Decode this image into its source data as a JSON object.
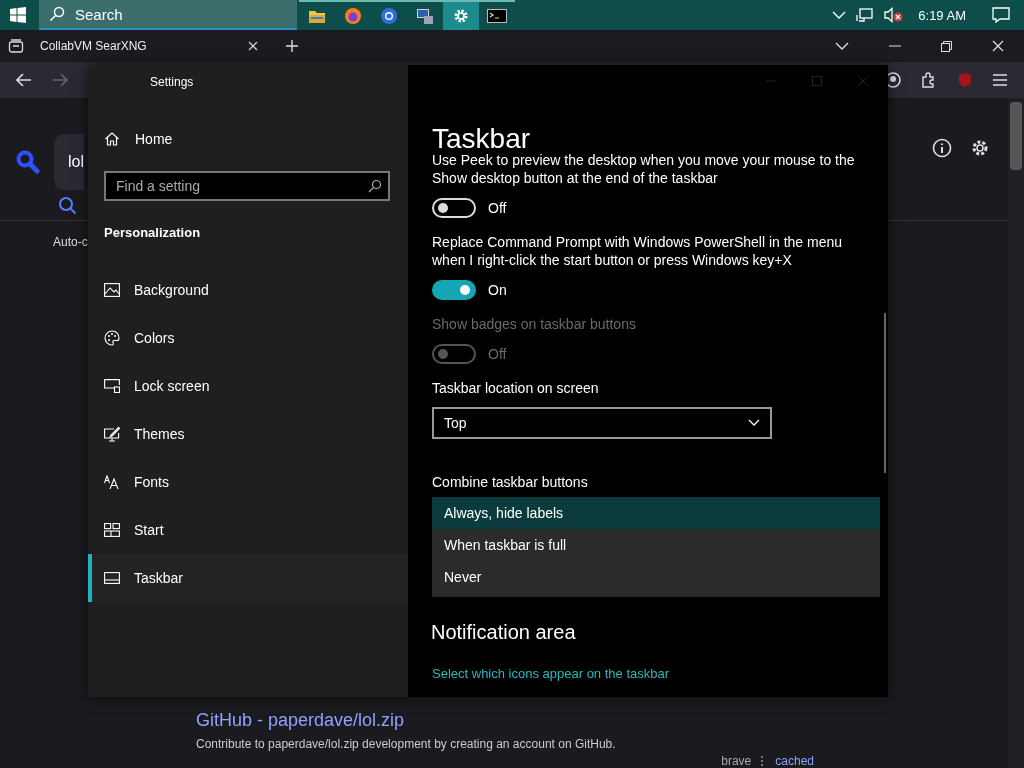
{
  "taskbar": {
    "search_placeholder": "Search",
    "apps": [
      {
        "selected": false
      },
      {
        "selected": false
      },
      {
        "selected": false
      },
      {
        "selected": false
      },
      {
        "selected": true
      },
      {
        "selected": false
      }
    ],
    "clock": "6:19 AM"
  },
  "browser": {
    "tab_title": "CollabVM SearXNG",
    "query": "lol",
    "auto_text": "Auto-c",
    "result": {
      "title": "GitHub - paperdave/lol.zip",
      "description": "Contribute to paperdave/lol.zip development by creating an account on GitHub.",
      "engine": "brave",
      "cached": "cached"
    }
  },
  "settings": {
    "title": "Settings",
    "home": "Home",
    "search_placeholder": "Find a setting",
    "section": "Personalization",
    "nav": [
      {
        "label": "Background",
        "selected": false
      },
      {
        "label": "Colors",
        "selected": false
      },
      {
        "label": "Lock screen",
        "selected": false
      },
      {
        "label": "Themes",
        "selected": false
      },
      {
        "label": "Fonts",
        "selected": false
      },
      {
        "label": "Start",
        "selected": false
      },
      {
        "label": "Taskbar",
        "selected": true
      }
    ],
    "page_title": "Taskbar",
    "content": [
      {
        "kind": "toggle",
        "label": "Use Peek to preview the desktop when you move your mouse to the Show desktop button at the end of the taskbar",
        "on": false,
        "disabled": false,
        "state_text": "Off"
      },
      {
        "kind": "toggle",
        "label": "Replace Command Prompt with Windows PowerShell in the menu when I right-click the start button or press Windows key+X",
        "on": true,
        "disabled": false,
        "state_text": "On"
      },
      {
        "kind": "toggle",
        "label": "Show badges on taskbar buttons",
        "on": false,
        "disabled": true,
        "state_text": "Off"
      },
      {
        "kind": "select",
        "label": "Taskbar location on screen",
        "value": "Top"
      },
      {
        "kind": "options",
        "label": "Combine taskbar buttons",
        "options": [
          {
            "label": "Always, hide labels",
            "selected": true
          },
          {
            "label": "When taskbar is full",
            "selected": false
          },
          {
            "label": "Never",
            "selected": false
          }
        ]
      },
      {
        "kind": "heading",
        "label": "Notification area"
      },
      {
        "kind": "link",
        "label": "Select which icons appear on the taskbar"
      }
    ]
  }
}
